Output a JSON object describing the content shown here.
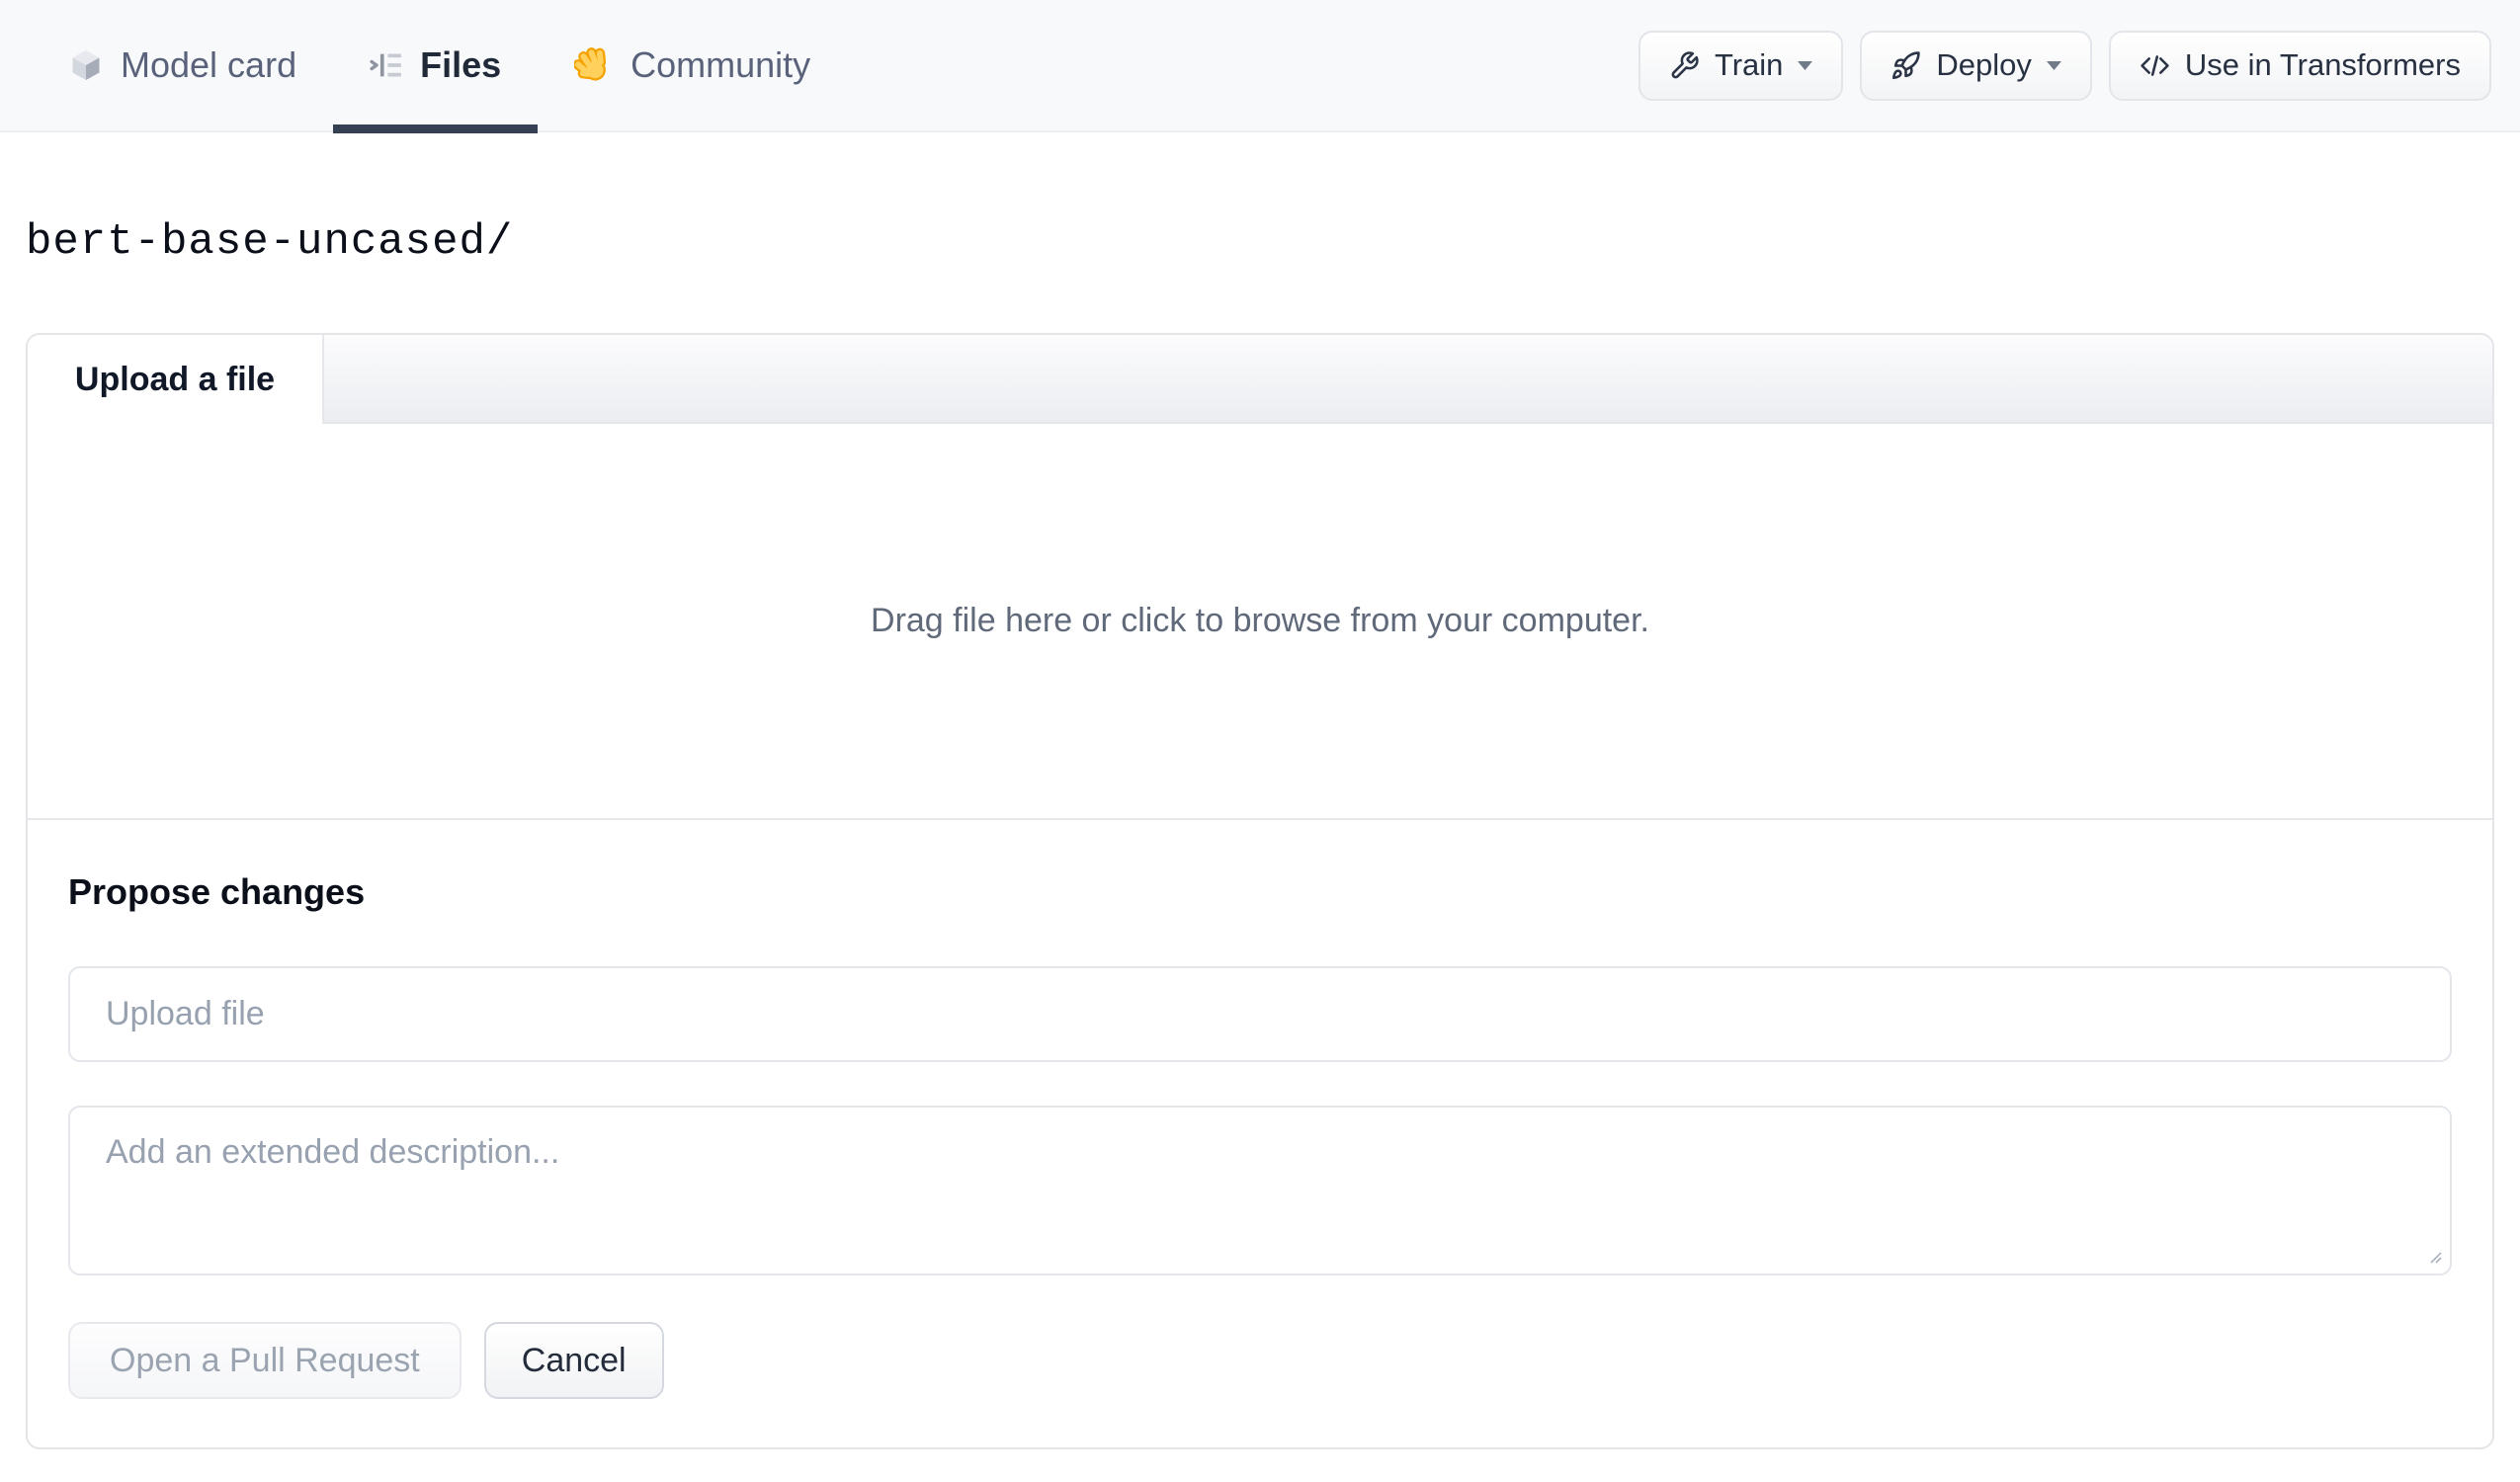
{
  "header": {
    "tabs": [
      {
        "label": "Model card",
        "icon": "cube-icon",
        "active": false
      },
      {
        "label": "Files",
        "icon": "files-icon",
        "active": true
      },
      {
        "label": "Community",
        "icon": "hand-icon",
        "active": false
      }
    ],
    "actions": [
      {
        "label": "Train",
        "icon": "wrench-icon",
        "has_dropdown": true
      },
      {
        "label": "Deploy",
        "icon": "rocket-icon",
        "has_dropdown": true
      },
      {
        "label": "Use in Transformers",
        "icon": "code-icon",
        "has_dropdown": false
      }
    ]
  },
  "breadcrumb": {
    "path": "bert-base-uncased/"
  },
  "upload_card": {
    "tab_label": "Upload a file",
    "dropzone_text": "Drag file here or click to browse from your computer.",
    "propose": {
      "heading": "Propose changes",
      "file_input_placeholder": "Upload file",
      "description_placeholder": "Add an extended description...",
      "primary_button": "Open a Pull Request",
      "cancel_button": "Cancel"
    }
  },
  "colors": {
    "topbar_bg": "#f8f9fb",
    "active_tab_underline": "#354052",
    "active_tab_text": "#1f2937",
    "inactive_tab_text": "#59627a",
    "border": "#e5e7eb",
    "placeholder_text": "#98a1af",
    "disabled_button_text": "#9aa3b0",
    "hand_emoji_fill": "#ffd15c",
    "hand_emoji_outline": "#f5a200"
  }
}
